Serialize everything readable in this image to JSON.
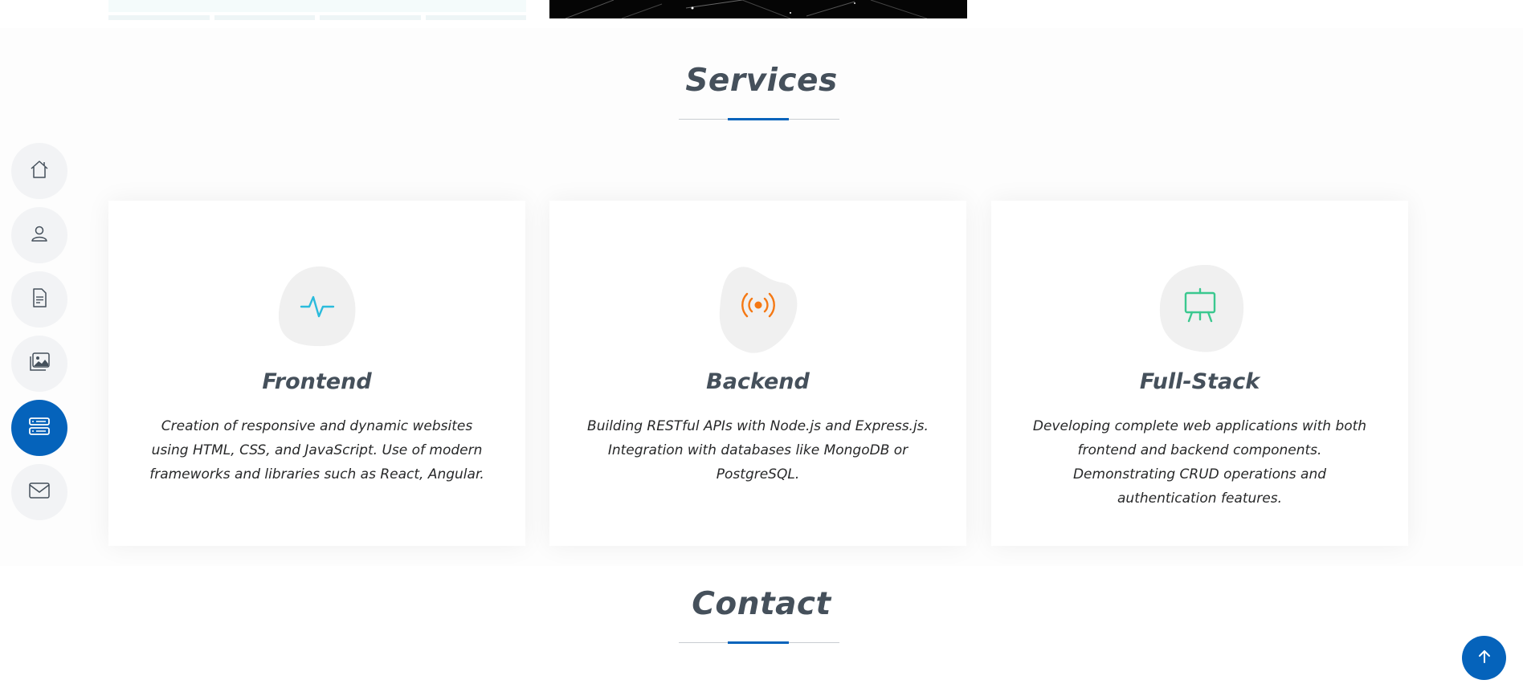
{
  "services": {
    "title": "Services",
    "cards": [
      {
        "title": "Frontend",
        "text": "Creation of responsive and dynamic websites using HTML, CSS, and JavaScript. Use of modern frameworks and libraries such as React, Angular.",
        "icon": "activity-icon",
        "color": "#2bbbdc"
      },
      {
        "title": "Backend",
        "text": "Building RESTful APIs with Node.js and Express.js. Integration with databases like MongoDB or PostgreSQL.",
        "icon": "broadcast-icon",
        "color": "#f57813"
      },
      {
        "title": "Full-Stack",
        "text": "Developing complete web applications with both frontend and backend components. Demonstrating CRUD operations and authentication features.",
        "icon": "easel-icon",
        "color": "#3ac88f"
      }
    ]
  },
  "contact": {
    "title": "Contact"
  },
  "nav": {
    "items": [
      {
        "icon": "house-icon",
        "active": false
      },
      {
        "icon": "person-icon",
        "active": false
      },
      {
        "icon": "file-text-icon",
        "active": false
      },
      {
        "icon": "images-icon",
        "active": false
      },
      {
        "icon": "server-icon",
        "active": true
      },
      {
        "icon": "envelope-icon",
        "active": false
      }
    ]
  },
  "colors": {
    "accent": "#0563bb",
    "heading": "#45505b",
    "text": "#272829"
  }
}
